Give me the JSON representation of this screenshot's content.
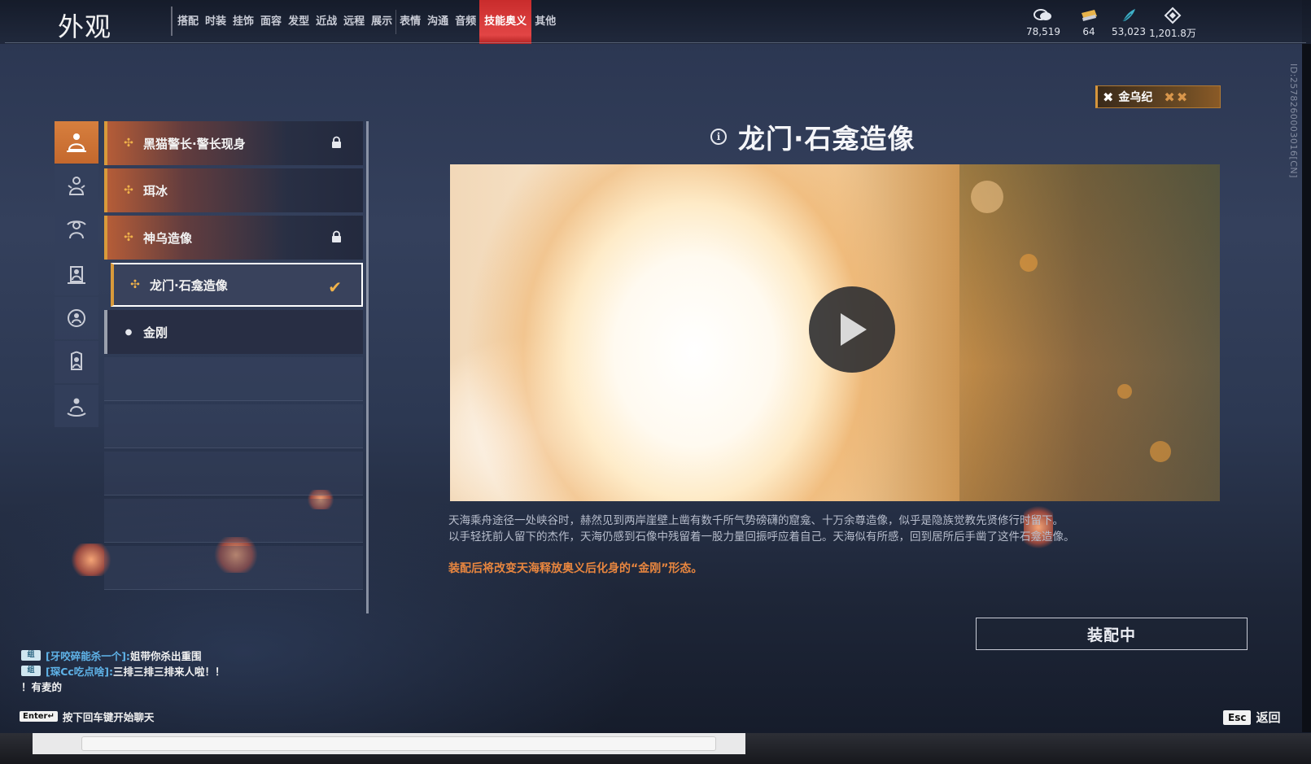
{
  "header": {
    "title": "外观",
    "tabs": [
      "搭配",
      "时装",
      "挂饰",
      "面容",
      "发型",
      "近战",
      "远程",
      "展示",
      "表情",
      "沟通",
      "音频",
      "技能奥义",
      "其他"
    ],
    "active_tab": "技能奥义"
  },
  "currencies": [
    {
      "icon": "coin-stack-icon",
      "value": "78,519"
    },
    {
      "icon": "ticket-icon",
      "value": "64"
    },
    {
      "icon": "feather-icon",
      "value": "53,023"
    },
    {
      "icon": "diamond-icon",
      "value": "1,201.8万"
    }
  ],
  "side_id": "ID:2578260003016[CN]",
  "list": {
    "items": [
      {
        "label": "黑猫警长·警长现身",
        "locked": true
      },
      {
        "label": "珥冰",
        "locked": false
      },
      {
        "label": "神乌造像",
        "locked": true
      },
      {
        "label": "龙门·石龛造像",
        "selected": true
      },
      {
        "label": "金刚",
        "plain": true
      }
    ]
  },
  "detail": {
    "set_badge": "金乌纪",
    "title": "龙门·石龛造像",
    "description_1": "天海乘舟途径一处峡谷时，赫然见到两岸崖壁上凿有数千所气势磅礴的窟龛、十万余尊造像，似乎是隐族觉教先贤修行时留下。",
    "description_2": "以手轻抚前人留下的杰作，天海仍感到石像中残留着一股力量回振呼应着自己。天海似有所感，回到居所后手凿了这件石龛造像。",
    "note": "装配后将改变天海释放奥义后化身的“金刚”形态。",
    "equip_button": "装配中"
  },
  "chat": {
    "lines": [
      {
        "name": "[牙咬碎能杀一个]:",
        "msg": "姐带你杀出重围"
      },
      {
        "name": "[琛Cc吃点啥]:",
        "msg": "三排三排三排来人啦！！"
      },
      {
        "name": "",
        "msg": "！有麦的"
      }
    ],
    "enter_key": "Enter↵",
    "hint": "按下回车键开始聊天"
  },
  "back": {
    "key": "Esc",
    "label": "返回"
  },
  "colors": {
    "accent_tab": "#d93a3a",
    "accent_orange": "#d99a3b",
    "note_orange": "#e8863f"
  }
}
